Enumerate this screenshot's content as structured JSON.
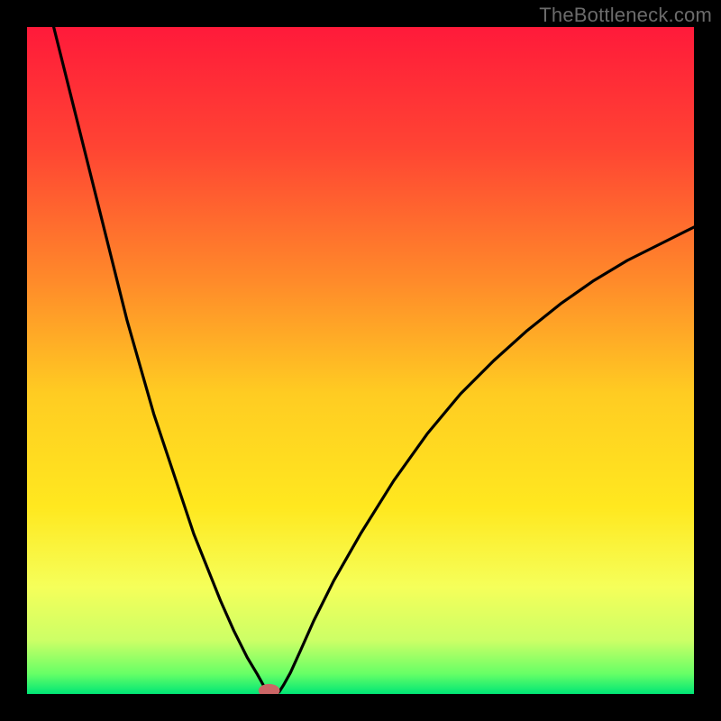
{
  "watermark": "TheBottleneck.com",
  "chart_data": {
    "type": "line",
    "title": "",
    "xlabel": "",
    "ylabel": "",
    "xlim": [
      0,
      100
    ],
    "ylim": [
      0,
      100
    ],
    "gradient_stops": [
      {
        "offset": 0.0,
        "color": "#ff1a3a"
      },
      {
        "offset": 0.18,
        "color": "#ff4433"
      },
      {
        "offset": 0.38,
        "color": "#ff8a2a"
      },
      {
        "offset": 0.55,
        "color": "#ffcc22"
      },
      {
        "offset": 0.72,
        "color": "#ffe81f"
      },
      {
        "offset": 0.84,
        "color": "#f5ff5a"
      },
      {
        "offset": 0.92,
        "color": "#ccff66"
      },
      {
        "offset": 0.97,
        "color": "#66ff66"
      },
      {
        "offset": 1.0,
        "color": "#00e676"
      }
    ],
    "series": [
      {
        "name": "bottleneck-curve",
        "type": "line",
        "points": [
          [
            4,
            100
          ],
          [
            5,
            96
          ],
          [
            7,
            88
          ],
          [
            9,
            80
          ],
          [
            11,
            72
          ],
          [
            13,
            64
          ],
          [
            15,
            56
          ],
          [
            17,
            49
          ],
          [
            19,
            42
          ],
          [
            21,
            36
          ],
          [
            23,
            30
          ],
          [
            25,
            24
          ],
          [
            27,
            19
          ],
          [
            29,
            14
          ],
          [
            31,
            9.5
          ],
          [
            33,
            5.5
          ],
          [
            34.5,
            3
          ],
          [
            35.5,
            1.2
          ],
          [
            36.2,
            0.3
          ],
          [
            36.8,
            0.05
          ],
          [
            37.2,
            0.05
          ],
          [
            37.8,
            0.3
          ],
          [
            38.5,
            1.4
          ],
          [
            39.5,
            3.2
          ],
          [
            41,
            6.5
          ],
          [
            43,
            11
          ],
          [
            46,
            17
          ],
          [
            50,
            24
          ],
          [
            55,
            32
          ],
          [
            60,
            39
          ],
          [
            65,
            45
          ],
          [
            70,
            50
          ],
          [
            75,
            54.5
          ],
          [
            80,
            58.5
          ],
          [
            85,
            62
          ],
          [
            90,
            65
          ],
          [
            95,
            67.5
          ],
          [
            100,
            70
          ]
        ]
      }
    ],
    "marker": {
      "x": 36.3,
      "y": 0.5,
      "rx": 1.6,
      "ry": 1.0,
      "color": "#cc6666"
    }
  }
}
